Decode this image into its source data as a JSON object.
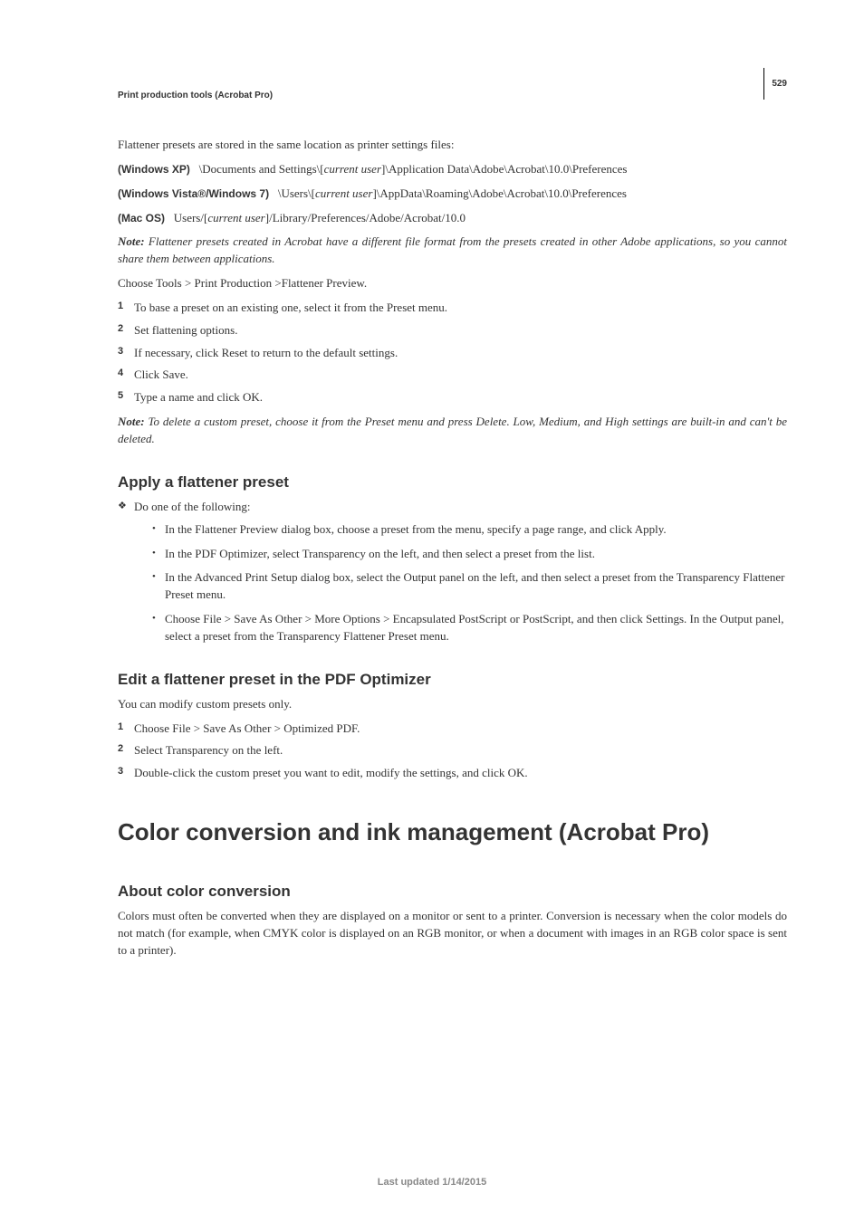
{
  "pageNumber": "529",
  "breadcrumb": "Print production tools (Acrobat Pro)",
  "intro": "Flattener presets are stored in the same location as printer settings files:",
  "paths": [
    {
      "label": "(Windows XP)",
      "pre": "\\Documents and Settings\\[",
      "user": "current user",
      "post": "]\\Application Data\\Adobe\\Acrobat\\10.0\\Preferences"
    },
    {
      "label": "(Windows Vista®/Windows 7)",
      "pre": "\\Users\\[",
      "user": "current user",
      "post": "]\\AppData\\Roaming\\Adobe\\Acrobat\\10.0\\Preferences"
    },
    {
      "label": "(Mac OS)",
      "pre": "Users/[",
      "user": "current user",
      "post": "]/Library/Preferences/Adobe/Acrobat/10.0"
    }
  ],
  "note1_label": "Note: ",
  "note1_body": "Flattener presets created in Acrobat have a different file format from the presets created in other Adobe applications, so you cannot share them between applications.",
  "choose": "Choose Tools > Print Production >Flattener Preview.",
  "steps1": [
    "To base a preset on an existing one, select it from the Preset menu.",
    "Set flattening options.",
    "If necessary, click Reset to return to the default settings.",
    "Click Save.",
    "Type a name and click OK."
  ],
  "note2_label": "Note: ",
  "note2_body": "To delete a custom preset, choose it from the Preset menu and press Delete. Low, Medium, and High settings are built-in and can't be deleted.",
  "sec_apply_title": "Apply a flattener preset",
  "apply_intro": "Do one of the following:",
  "apply_items": [
    "In the Flattener Preview dialog box, choose a preset from the menu, specify a page range, and click Apply.",
    "In the PDF Optimizer, select Transparency on the left, and then select a preset from the list.",
    "In the Advanced Print Setup dialog box, select the Output panel on the left, and then select a preset from the Transparency Flattener Preset menu.",
    "Choose File > Save As Other > More Options > Encapsulated PostScript or PostScript, and then click Settings. In the Output panel, select a preset from the Transparency Flattener Preset menu."
  ],
  "sec_edit_title": "Edit a flattener preset in the PDF Optimizer",
  "edit_intro": "You can modify custom presets only.",
  "steps2": [
    "Choose File > Save As Other > Optimized PDF.",
    "Select Transparency on the left.",
    "Double-click the custom preset you want to edit, modify the settings, and click OK."
  ],
  "h1": "Color conversion and ink management (Acrobat Pro)",
  "sec_about_title": "About color conversion",
  "about_body": "Colors must often be converted when they are displayed on a monitor or sent to a printer. Conversion is necessary when the color models do not match (for example, when CMYK color is displayed on an RGB monitor, or when a document with images in an RGB color space is sent to a printer).",
  "footer": "Last updated 1/14/2015"
}
